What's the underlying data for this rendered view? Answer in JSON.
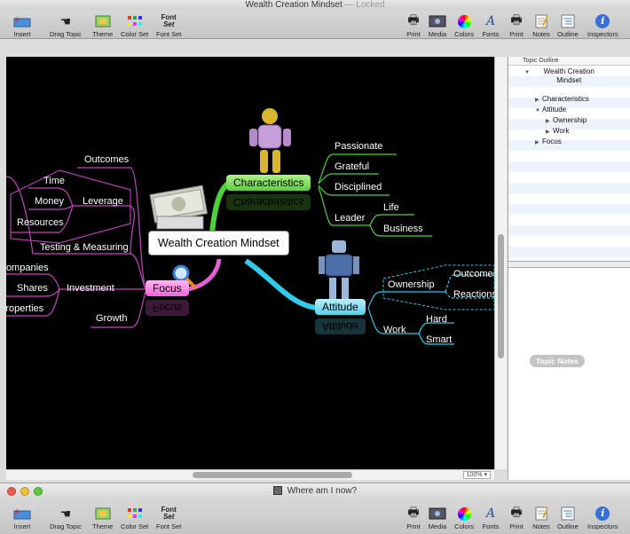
{
  "window1": {
    "title": "Wealth Creation Mindset",
    "title_suffix": "— Locked",
    "toolbar": {
      "insert": "Insert",
      "drag_topic": "Drag Topic",
      "theme": "Theme",
      "color_set": "Color Set",
      "font_set": "Font Set",
      "font_glyph_top": "Font",
      "font_glyph_bottom": "Set",
      "print": "Print",
      "media": "Media",
      "colors": "Colors",
      "fonts": "Fonts",
      "print2": "Print",
      "notes": "Notes",
      "outline": "Outline",
      "inspectors": "Inspectors"
    },
    "zoom": "100%",
    "outline": {
      "header": "Topic Outline",
      "items": [
        {
          "label": "Wealth Creation Mindset",
          "tri": "▼"
        },
        {
          "label": "Characteristics",
          "tri": "▶"
        },
        {
          "label": "Attitude",
          "tri": "▼"
        },
        {
          "label": "Ownership",
          "tri": "▶"
        },
        {
          "label": "Work",
          "tri": "▶"
        },
        {
          "label": "Focus",
          "tri": "▶"
        }
      ]
    },
    "notes_label": "Topic Notes",
    "mindmap": {
      "central": "Wealth Creation Mindset",
      "characteristics": "Characteristics",
      "passionate": "Passionate",
      "grateful": "Grateful",
      "disciplined": "Disciplined",
      "leader": "Leader",
      "life": "Life",
      "business": "Business",
      "attitude": "Attitude",
      "ownership": "Ownership",
      "outcomes_right": "Outcomes",
      "reactions": "Reactions",
      "work": "Work",
      "hard": "Hard",
      "smart": "Smart",
      "focus": "Focus",
      "outcomes_left": "Outcomes",
      "time": "Time",
      "money": "Money",
      "resources": "Resources",
      "leverage": "Leverage",
      "testing": "Testing & Measuring",
      "companies": "Companies",
      "shares": "Shares",
      "properties": "Properties",
      "investment": "Investment",
      "growth": "Growth"
    }
  },
  "window2": {
    "title": "Where am I now?",
    "toolbar": {
      "insert": "Insert",
      "drag_topic": "Drag Topic",
      "theme": "Theme",
      "color_set": "Color Set",
      "font_set": "Font Set",
      "font_glyph_top": "Font",
      "font_glyph_bottom": "Set",
      "print": "Print",
      "media": "Media",
      "colors": "Colors",
      "fonts": "Fonts",
      "print2": "Print",
      "notes": "Notes",
      "outline": "Outline",
      "inspectors": "Inspectors"
    }
  }
}
